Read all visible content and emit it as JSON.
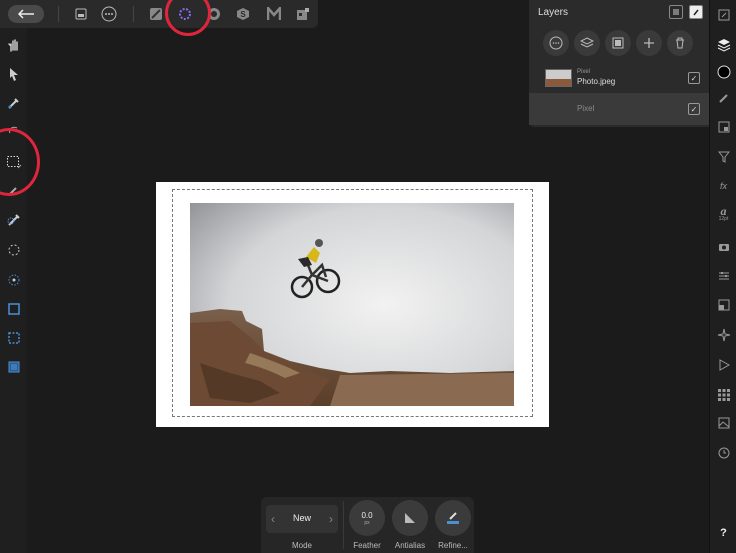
{
  "topbar": {
    "icons": [
      "back-arrow-icon",
      "document-icon",
      "more-icon",
      "pixel-persona-icon",
      "selection-brush-persona-icon",
      "develop-persona-icon",
      "export-persona-icon",
      "tone-map-persona-icon",
      "liquify-persona-icon"
    ]
  },
  "layers_panel": {
    "title": "Layers",
    "layers": [
      {
        "type": "Pixel",
        "name": "Photo.jpeg",
        "checked": "✓"
      },
      {
        "type": "",
        "name": "Pixel",
        "checked": "✓"
      }
    ]
  },
  "right_strip": {
    "text_label": "12pt",
    "fx_label": "fx",
    "help_label": "?"
  },
  "context_bar": {
    "mode_value": "New",
    "mode_label": "Mode",
    "feather_value": "0.0",
    "feather_unit": "px",
    "feather_label": "Feather",
    "antialias_label": "Antialias",
    "refine_label": "Refine..."
  },
  "colors": {
    "annotation_red": "#e0263c",
    "selection_accent": "#4a90d9"
  }
}
